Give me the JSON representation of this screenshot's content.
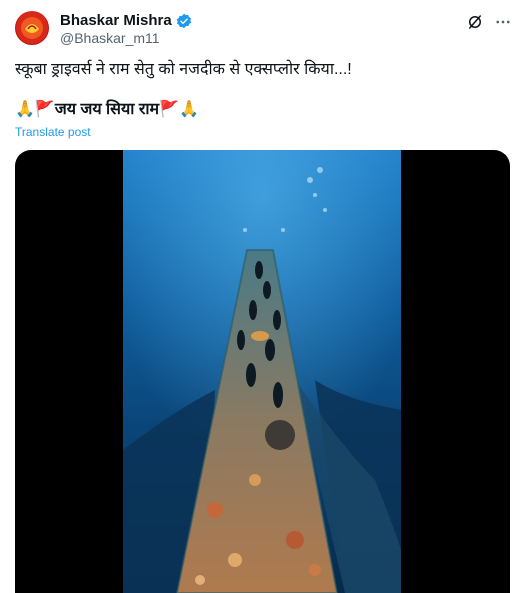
{
  "author": {
    "display_name": "Bhaskar Mishra",
    "handle": "@Bhaskar_m11",
    "verified": true
  },
  "post": {
    "text_line1": "स्कूबा ड्राइवर्स ने राम सेतु को नजदीक से एक्सप्लोर किया...!",
    "text_line2": "🙏🚩जय जय सिया राम🚩🙏",
    "translate_label": "Translate post"
  },
  "media": {
    "kind": "video",
    "description_icon": "underwater-video"
  },
  "icons": {
    "grok": "grok-icon",
    "more": "more-icon",
    "verified": "verified-badge-icon"
  },
  "colors": {
    "link": "#1d9bf0",
    "verified": "#1d9bf0",
    "text_secondary": "#536471"
  }
}
